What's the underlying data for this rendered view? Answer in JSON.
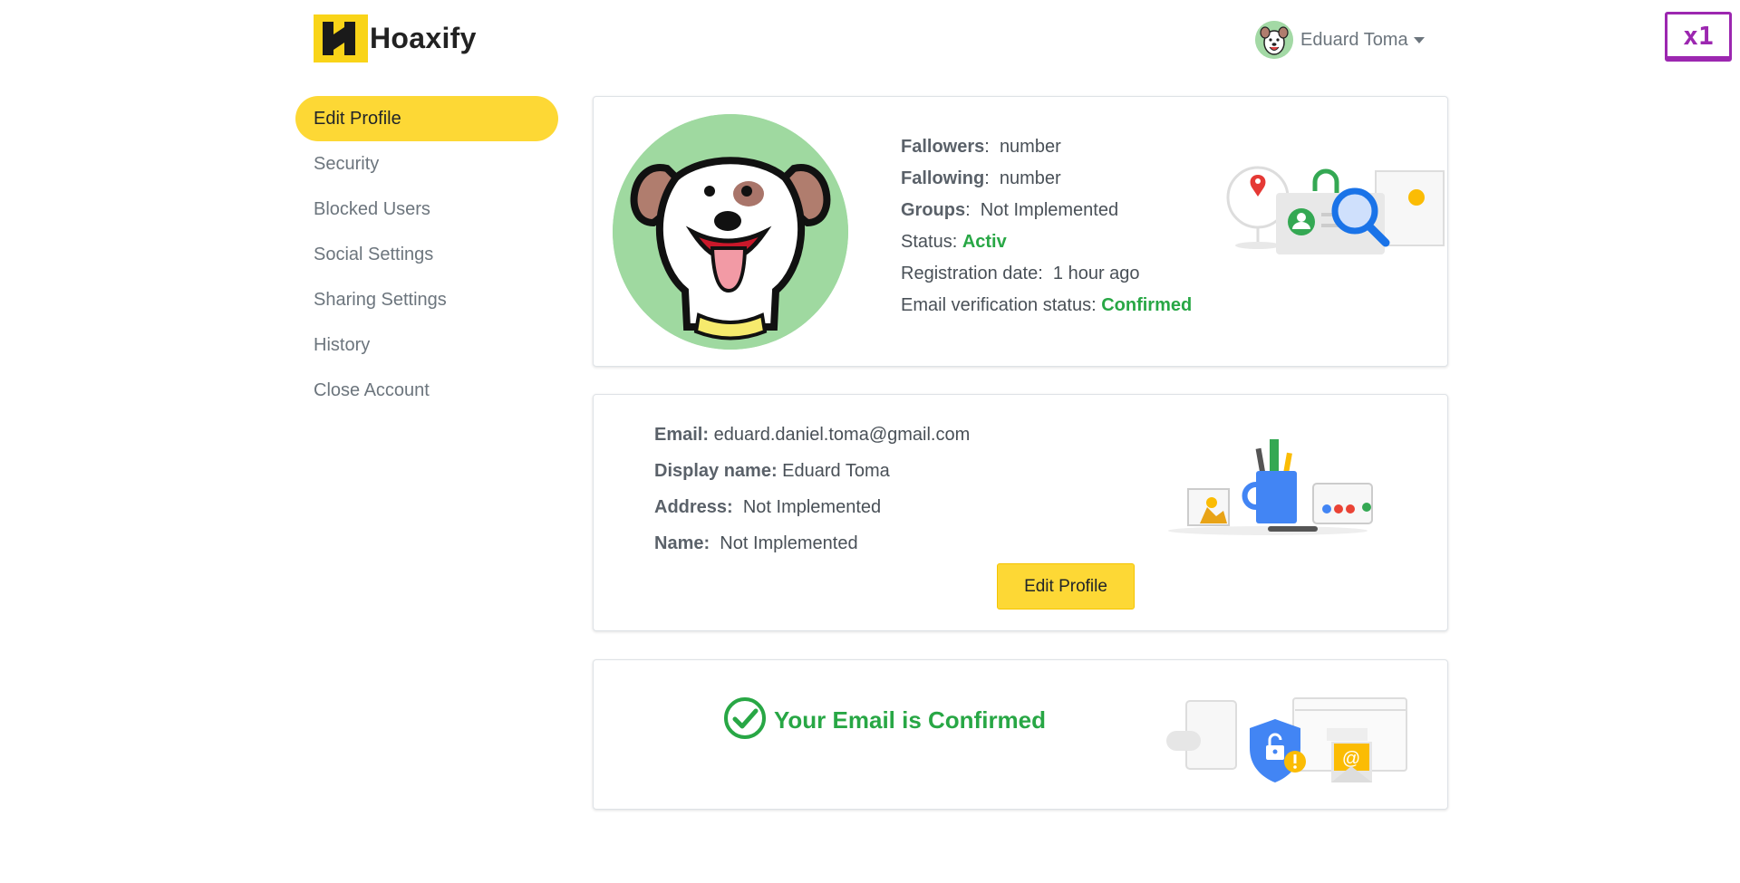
{
  "header": {
    "brand": "Hoaxify",
    "user_name": "Eduard Toma",
    "badge": "x1"
  },
  "sidebar": {
    "items": [
      {
        "label": "Edit Profile",
        "active": true
      },
      {
        "label": "Security"
      },
      {
        "label": "Blocked Users"
      },
      {
        "label": "Social Settings"
      },
      {
        "label": "Sharing Settings"
      },
      {
        "label": "History"
      },
      {
        "label": "Close Account"
      }
    ]
  },
  "profile_card": {
    "followers_label": "Fallowers",
    "followers_value": "number",
    "following_label": "Fallowing",
    "following_value": "number",
    "groups_label": "Groups",
    "groups_value": "Not Implemented",
    "status_label": "Status:",
    "status_value": "Activ",
    "registration_label": "Registration date:",
    "registration_value": "1 hour ago",
    "email_verification_label": "Email verification status:",
    "email_verification_value": "Confirmed"
  },
  "details_card": {
    "email_label": "Email:",
    "email_value": "eduard.daniel.toma@gmail.com",
    "display_name_label": "Display name:",
    "display_name_value": "Eduard Toma",
    "address_label": "Address:",
    "address_value": "Not Implemented",
    "name_label": "Name:",
    "name_value": "Not Implemented",
    "edit_button": "Edit Profile"
  },
  "confirm_card": {
    "message": "Your Email is Confirmed"
  },
  "colors": {
    "accent": "#fdd835",
    "success": "#28a745",
    "muted": "#6c757d"
  }
}
